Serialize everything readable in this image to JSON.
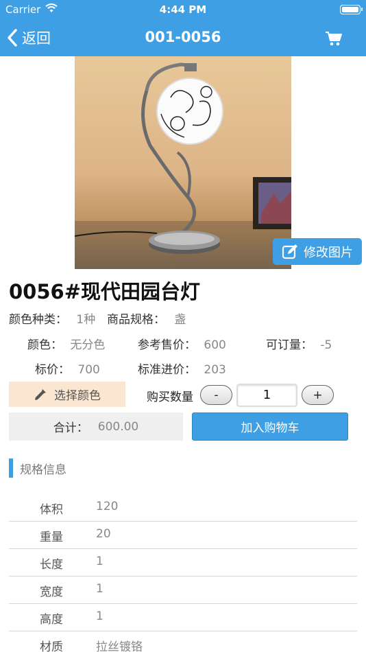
{
  "status_bar": {
    "carrier": "Carrier",
    "time": "4:44 PM"
  },
  "nav": {
    "back_label": "返回",
    "title": "001-0056"
  },
  "photo": {
    "edit_label": "修改图片"
  },
  "product": {
    "name": "0056#现代田园台灯",
    "color_types_label": "颜色种类：",
    "color_types_value": "1种",
    "spec_label": "商品规格：",
    "spec_value": "盏",
    "color_label": "颜色：",
    "color_value": "无分色",
    "ref_price_label": "参考售价：",
    "ref_price_value": "600",
    "orderable_label": "可订量：",
    "orderable_value": "-5",
    "list_price_label": "标价：",
    "list_price_value": "700",
    "std_cost_label": "标准进价：",
    "std_cost_value": "203"
  },
  "purchase": {
    "pick_color_label": "选择颜色",
    "qty_label": "购买数量",
    "minus": "-",
    "plus": "+",
    "qty_value": "1",
    "total_label": "合计：",
    "total_value": "600.00",
    "add_to_cart": "加入购物车"
  },
  "spec_section": {
    "title": "规格信息",
    "rows": [
      {
        "key": "体积",
        "value": "120"
      },
      {
        "key": "重量",
        "value": "20"
      },
      {
        "key": "长度",
        "value": "1"
      },
      {
        "key": "宽度",
        "value": "1"
      },
      {
        "key": "高度",
        "value": "1"
      },
      {
        "key": "材质",
        "value": "拉丝镀铬"
      }
    ]
  },
  "colors": {
    "accent": "#3f9fe4",
    "pick_color_bg": "#fbe6d2",
    "total_bg": "#efefef"
  },
  "icons": [
    "wifi-icon",
    "battery-icon",
    "back-chevron-icon",
    "cart-icon",
    "edit-icon",
    "eyedropper-icon"
  ]
}
